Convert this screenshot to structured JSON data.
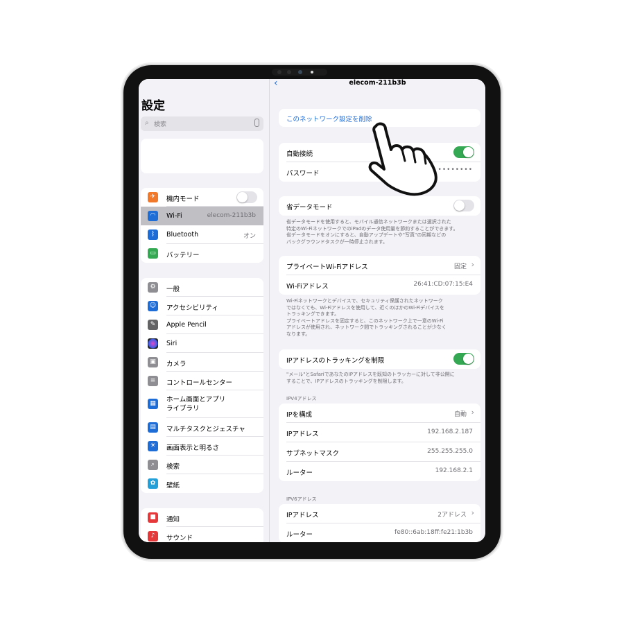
{
  "sidebar": {
    "title": "設定",
    "search_placeholder": "検索",
    "group1": [
      {
        "label": "機内モード",
        "icon": "airplane-icon",
        "color": "#f0792b",
        "toggle": false
      },
      {
        "label": "Wi-Fi",
        "value": "elecom-211b3b",
        "icon": "wifi-icon",
        "color": "#1e6cd6",
        "selected": true
      },
      {
        "label": "Bluetooth",
        "value": "オン",
        "icon": "bluetooth-icon",
        "color": "#1e6cd6"
      },
      {
        "label": "バッテリー",
        "icon": "battery-icon",
        "color": "#34a853"
      }
    ],
    "group2": [
      {
        "label": "一般",
        "icon": "gear-icon",
        "color": "#8e8e93"
      },
      {
        "label": "アクセシビリティ",
        "icon": "accessibility-icon",
        "color": "#1e6cd6"
      },
      {
        "label": "Apple Pencil",
        "icon": "pencil-icon",
        "color": "#636366"
      },
      {
        "label": "Siri",
        "icon": "siri-icon",
        "color": "#222222"
      },
      {
        "label": "カメラ",
        "icon": "camera-icon",
        "color": "#8e8e93"
      },
      {
        "label": "コントロールセンター",
        "icon": "control-center-icon",
        "color": "#8e8e93"
      },
      {
        "label_line1": "ホーム画面とアプリ",
        "label_line2": "ライブラリ",
        "icon": "home-screen-icon",
        "color": "#1e6cd6"
      },
      {
        "label": "マルチタスクとジェスチャ",
        "icon": "multitask-icon",
        "color": "#1e6cd6"
      },
      {
        "label": "画面表示と明るさ",
        "icon": "brightness-icon",
        "color": "#1e6cd6"
      },
      {
        "label": "検索",
        "icon": "search-icon",
        "color": "#8e8e93"
      },
      {
        "label": "壁紙",
        "icon": "wallpaper-icon",
        "color": "#23a0d8"
      }
    ],
    "group3": [
      {
        "label": "通知",
        "icon": "notification-icon",
        "color": "#e5383b"
      },
      {
        "label": "サウンド",
        "icon": "sound-icon",
        "color": "#e5383b"
      }
    ]
  },
  "detail": {
    "title": "elecom-211b3b",
    "forget_label": "このネットワーク設定を削除",
    "auto_join": {
      "label": "自動接続",
      "on": true
    },
    "password": {
      "label": "パスワード",
      "value": "••••••••"
    },
    "low_data": {
      "label": "省データモード",
      "on": false
    },
    "low_data_note": [
      "省データモードを使用すると、モバイル通信ネットワークまたは選択された",
      "特定のWi-FiネットワークでのiPadのデータ使用量を節約することができます。",
      "省データモードをオンにすると、自動アップデートや\"写真\"の同期などの",
      "バックグラウンドタスクが一時停止されます。"
    ],
    "private_address": {
      "label": "プライベートWi-Fiアドレス",
      "value": "固定"
    },
    "wifi_address": {
      "label": "Wi-Fiアドレス",
      "value": "26:41:CD:07:15:E4"
    },
    "wifi_note": [
      "Wi-Fiネットワークとデバイスで、セキュリティ保護されたネットワーク",
      "ではなくても、Wi-Fiアドレスを使用して、近くのほかのWi-Fiデバイスを",
      "トラッキングできます。",
      "プライベートアドレスを固定すると、このネットワーク上で一意のWi-Fi",
      "アドレスが使用され、ネットワーク間でトラッキングされることが少なく",
      "なります。"
    ],
    "limit_tracking": {
      "label": "IPアドレスのトラッキングを制限",
      "on": true
    },
    "tracking_note": [
      "\"メール\"とSafariであなたのIPアドレスを既知のトラッカーに対して非公開に",
      "することで、IPアドレスのトラッキングを制限します。"
    ],
    "ipv4_header": "IPV4アドレス",
    "ipv4": {
      "configure": {
        "label": "IPを構成",
        "value": "自動"
      },
      "ip": {
        "label": "IPアドレス",
        "value": "192.168.2.187"
      },
      "subnet": {
        "label": "サブネットマスク",
        "value": "255.255.255.0"
      },
      "router": {
        "label": "ルーター",
        "value": "192.168.2.1"
      }
    },
    "ipv6_header": "IPV6アドレス",
    "ipv6": {
      "ip": {
        "label": "IPアドレス",
        "value": "2アドレス"
      },
      "router": {
        "label": "ルーター",
        "value": "fe80::6ab:18ff:fe21:1b3b"
      }
    }
  },
  "colors": {
    "accent": "#1e6cd6",
    "toggle_on": "#34a853"
  }
}
